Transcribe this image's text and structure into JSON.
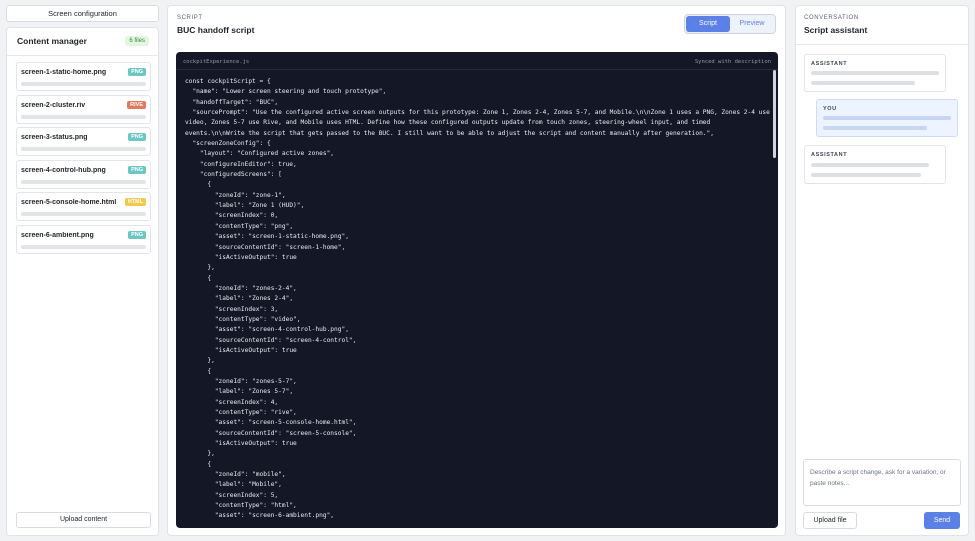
{
  "left": {
    "config_button": "Screen configuration",
    "title": "Content manager",
    "count": "6 files",
    "files": [
      {
        "name": "screen-1-static-home.png",
        "badge": "PNG",
        "badge_color": "#6cc6c1"
      },
      {
        "name": "screen-2-cluster.riv",
        "badge": "RIVE",
        "badge_color": "#e07a5f"
      },
      {
        "name": "screen-3-status.png",
        "badge": "PNG",
        "badge_color": "#6cc6c1"
      },
      {
        "name": "screen-4-control-hub.png",
        "badge": "PNG",
        "badge_color": "#6cc6c1"
      },
      {
        "name": "screen-5-console-home.html",
        "badge": "HTML",
        "badge_color": "#f2c94c"
      },
      {
        "name": "screen-6-ambient.png",
        "badge": "PNG",
        "badge_color": "#6cc6c1"
      }
    ],
    "upload_button": "Upload content"
  },
  "center": {
    "label": "SCRIPT",
    "title": "BUC handoff script",
    "toggle": {
      "script": "Script",
      "preview": "Preview",
      "active": "Script"
    },
    "file_name": "cockpitExperience.js",
    "sync_status": "Synced with description",
    "code": "const cockpitScript = {\n  \"name\": \"Lower screen steering and touch prototype\",\n  \"handoffTarget\": \"BUC\",\n  \"sourcePrompt\": \"Use the configured active screen outputs for this prototype: Zone 1, Zones 2-4, Zones 5-7, and Mobile.\\n\\nZone 1 uses a PNG, Zones 2-4 use video, Zones 5-7 use Rive, and Mobile uses HTML. Define how these configured outputs update from touch zones, steering-wheel input, and timed events.\\n\\nWrite the script that gets passed to the BUC. I still want to be able to adjust the script and content manually after generation.\",\n  \"screenZoneConfig\": {\n    \"layout\": \"Configured active zones\",\n    \"configureInEditor\": true,\n    \"configuredScreens\": [\n      {\n        \"zoneId\": \"zone-1\",\n        \"label\": \"Zone 1 (HUD)\",\n        \"screenIndex\": 0,\n        \"contentType\": \"png\",\n        \"asset\": \"screen-1-static-home.png\",\n        \"sourceContentId\": \"screen-1-home\",\n        \"isActiveOutput\": true\n      },\n      {\n        \"zoneId\": \"zones-2-4\",\n        \"label\": \"Zones 2-4\",\n        \"screenIndex\": 3,\n        \"contentType\": \"video\",\n        \"asset\": \"screen-4-control-hub.png\",\n        \"sourceContentId\": \"screen-4-control\",\n        \"isActiveOutput\": true\n      },\n      {\n        \"zoneId\": \"zones-5-7\",\n        \"label\": \"Zones 5-7\",\n        \"screenIndex\": 4,\n        \"contentType\": \"rive\",\n        \"asset\": \"screen-5-console-home.html\",\n        \"sourceContentId\": \"screen-5-console\",\n        \"isActiveOutput\": true\n      },\n      {\n        \"zoneId\": \"mobile\",\n        \"label\": \"Mobile\",\n        \"screenIndex\": 5,\n        \"contentType\": \"html\",\n        \"asset\": \"screen-6-ambient.png\","
  },
  "right": {
    "label": "CONVERSATION",
    "title": "Script assistant",
    "messages": [
      {
        "who": "ASSISTANT"
      },
      {
        "who": "YOU"
      },
      {
        "who": "ASSISTANT"
      }
    ],
    "input_placeholder": "Describe a script change, ask for a variation, or paste notes...",
    "upload_button": "Upload file",
    "send_button": "Send"
  },
  "colors": {
    "accent": "#5b80e6",
    "code_bg": "#141826"
  }
}
